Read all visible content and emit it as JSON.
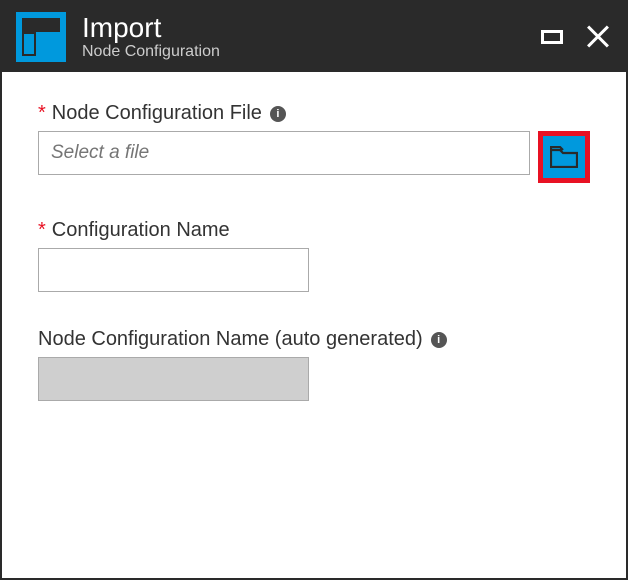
{
  "header": {
    "title": "Import",
    "subtitle": "Node Configuration"
  },
  "fields": {
    "file": {
      "label": "Node Configuration File",
      "placeholder": "Select a file",
      "required_mark": "*"
    },
    "config_name": {
      "label": "Configuration Name",
      "required_mark": "*",
      "value": ""
    },
    "node_name": {
      "label": "Node Configuration Name (auto generated)",
      "value": ""
    }
  },
  "info_glyph": "i",
  "colors": {
    "accent": "#0099dd",
    "danger": "#e81123",
    "header_bg": "#2a2a2a"
  }
}
